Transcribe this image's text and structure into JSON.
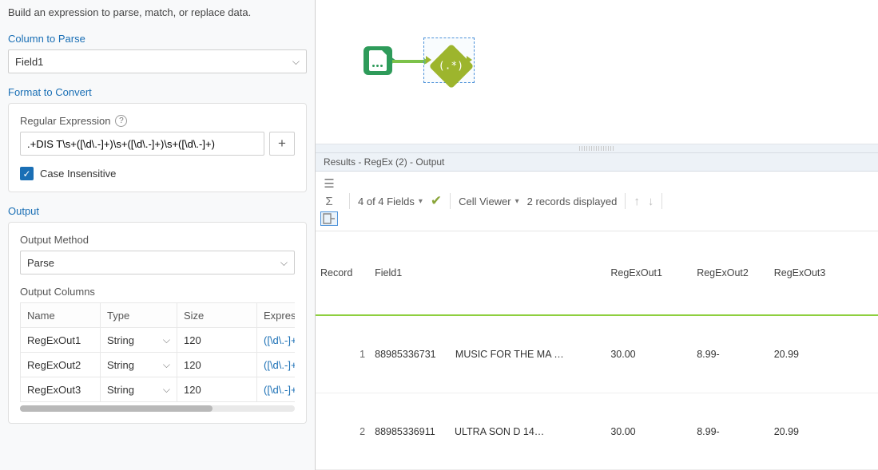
{
  "intro": "Build an expression to parse, match, or replace data.",
  "column_to_parse": {
    "label": "Column to Parse",
    "value": "Field1"
  },
  "format": {
    "label": "Format to Convert",
    "regex_label": "Regular Expression",
    "regex_value": ".+DIS T\\s+([\\d\\.-]+)\\s+([\\d\\.-]+)\\s+([\\d\\.-]+)",
    "case_insensitive_label": "Case Insensitive"
  },
  "output": {
    "label": "Output",
    "method_label": "Output Method",
    "method_value": "Parse",
    "columns_label": "Output Columns",
    "headers": {
      "name": "Name",
      "type": "Type",
      "size": "Size",
      "expr": "Expressi"
    },
    "rows": [
      {
        "name": "RegExOut1",
        "type": "String",
        "size": "120",
        "expr": "([\\d\\.-]+"
      },
      {
        "name": "RegExOut2",
        "type": "String",
        "size": "120",
        "expr": "([\\d\\.-]+"
      },
      {
        "name": "RegExOut3",
        "type": "String",
        "size": "120",
        "expr": "([\\d\\.-]+"
      }
    ]
  },
  "canvas": {
    "tool1": "input-tool-icon",
    "tool2_text": "(.*)"
  },
  "results": {
    "title": "Results - RegEx (2) - Output",
    "fields_text": "4 of 4 Fields",
    "cell_viewer": "Cell Viewer",
    "records_text": "2 records displayed",
    "headers": [
      "Record",
      "Field1",
      "RegExOut1",
      "RegExOut2",
      "RegExOut3"
    ],
    "rows": [
      {
        "n": "1",
        "f1a": "88985336731",
        "f1b": "MUSIC FOR THE MA …",
        "r1": "30.00",
        "r2": "8.99-",
        "r3": "20.99"
      },
      {
        "n": "2",
        "f1a": "88985336911",
        "f1b": "ULTRA               SON D 14…",
        "r1": "30.00",
        "r2": "8.99-",
        "r3": "20.99"
      }
    ]
  }
}
